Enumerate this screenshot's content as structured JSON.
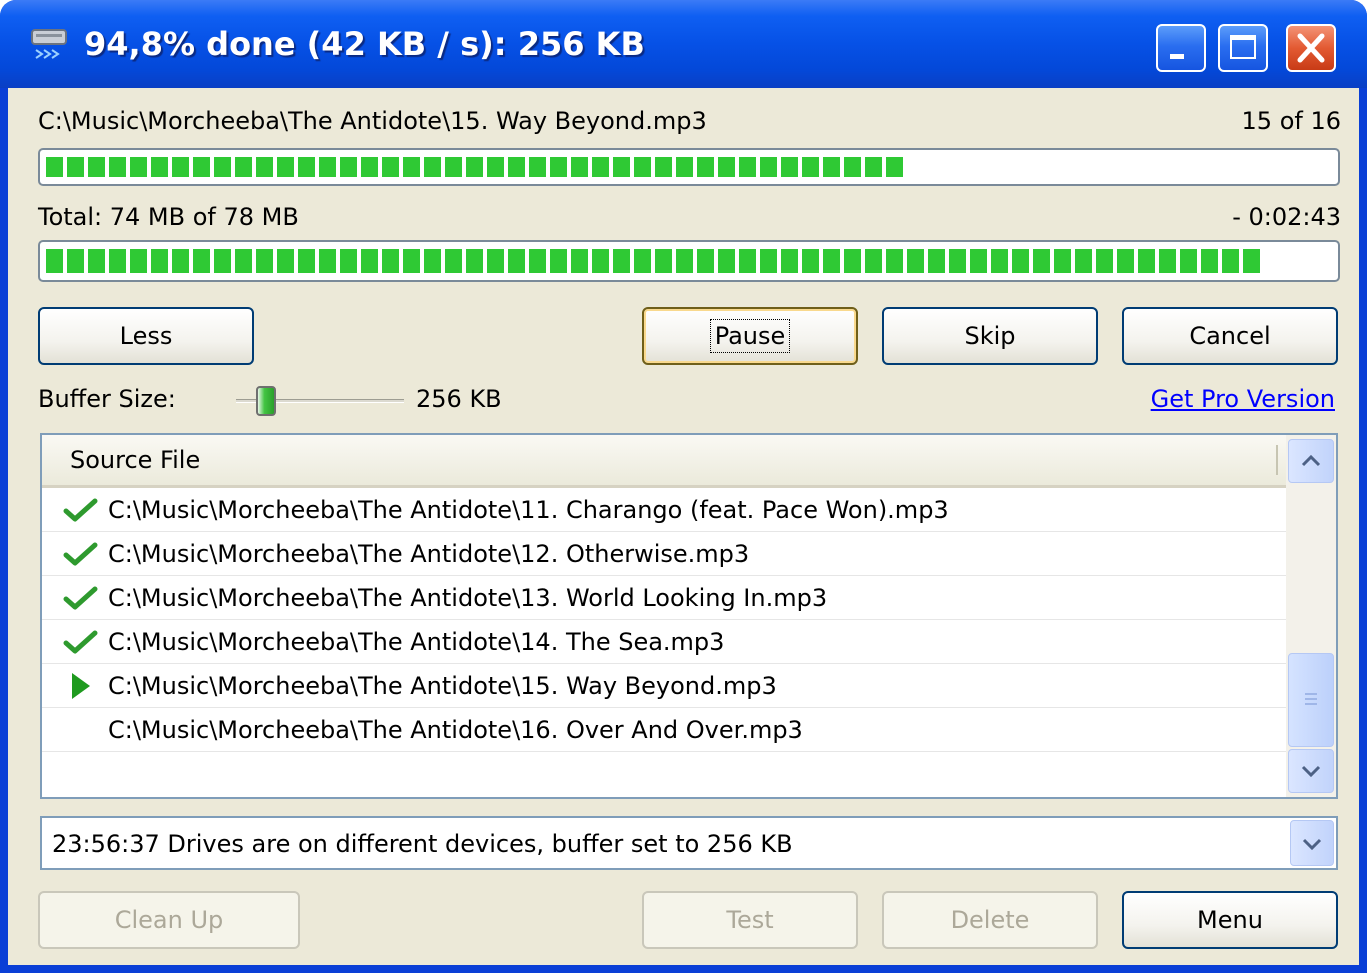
{
  "window": {
    "title": "94,8% done (42 KB / s): 256 KB",
    "icon": "drive-icon"
  },
  "current_file": {
    "path": "C:\\Music\\Morcheeba\\The Antidote\\15. Way Beyond.mp3",
    "position": "15 of 16",
    "progress_fraction": 0.68
  },
  "total": {
    "label": "Total: 74 MB of 78 MB",
    "remaining": "- 0:02:43",
    "progress_fraction": 0.948
  },
  "buttons": {
    "less": "Less",
    "pause": "Pause",
    "skip": "Skip",
    "cancel": "Cancel",
    "clean_up": "Clean Up",
    "test": "Test",
    "delete": "Delete",
    "menu": "Menu"
  },
  "buffer": {
    "label": "Buffer Size:",
    "value": "256 KB"
  },
  "pro_link": "Get Pro Version",
  "file_list": {
    "column_header": "Source File",
    "rows": [
      {
        "status": "done",
        "path": "C:\\Music\\Morcheeba\\The Antidote\\11. Charango (feat. Pace Won).mp3"
      },
      {
        "status": "done",
        "path": "C:\\Music\\Morcheeba\\The Antidote\\12. Otherwise.mp3"
      },
      {
        "status": "done",
        "path": "C:\\Music\\Morcheeba\\The Antidote\\13. World Looking In.mp3"
      },
      {
        "status": "done",
        "path": "C:\\Music\\Morcheeba\\The Antidote\\14. The Sea.mp3"
      },
      {
        "status": "current",
        "path": "C:\\Music\\Morcheeba\\The Antidote\\15. Way Beyond.mp3"
      },
      {
        "status": "pending",
        "path": "C:\\Music\\Morcheeba\\The Antidote\\16. Over And Over.mp3"
      }
    ]
  },
  "log": {
    "message": "23:56:37 Drives are on different devices, buffer set to 256 KB"
  },
  "colors": {
    "progress_green": "#2fc934",
    "check_green": "#2e9a2e",
    "link_blue": "#0000ff",
    "titlebar_blue": "#0651e6",
    "close_red": "#e35a32"
  }
}
